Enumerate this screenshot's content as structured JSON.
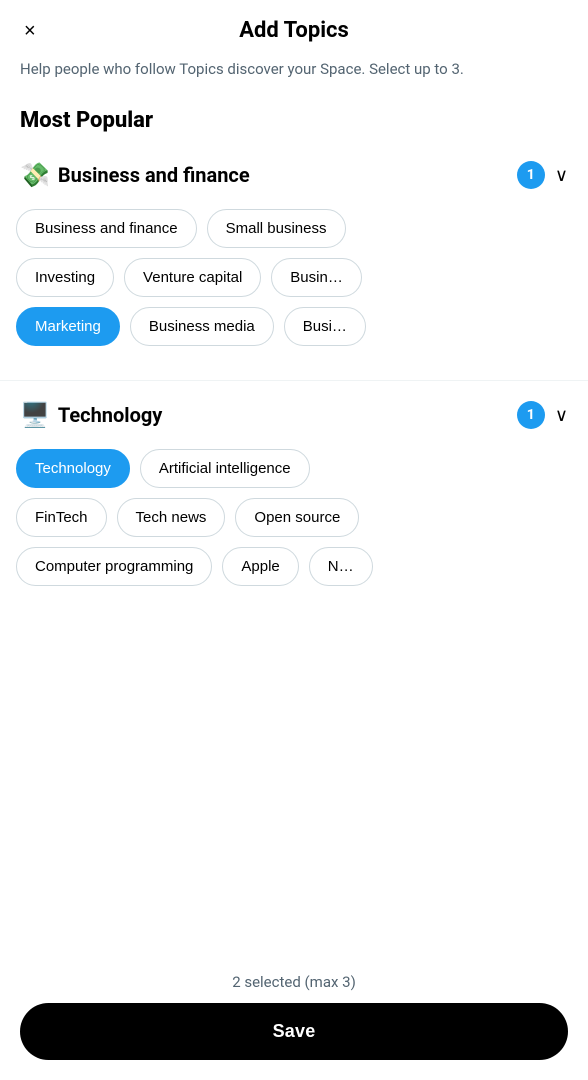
{
  "header": {
    "title": "Add Topics",
    "close_icon": "×"
  },
  "subtitle": "Help people who follow Topics discover your Space. Select up to 3.",
  "most_popular_label": "Most Popular",
  "categories": [
    {
      "id": "business",
      "emoji": "💸",
      "title": "Business and finance",
      "badge": "1",
      "rows": [
        [
          {
            "label": "Business and finance",
            "selected": false,
            "partial": false
          },
          {
            "label": "Small business",
            "selected": false,
            "partial": true
          }
        ],
        [
          {
            "label": "Investing",
            "selected": false,
            "partial": false
          },
          {
            "label": "Venture capital",
            "selected": false,
            "partial": false
          },
          {
            "label": "Busin…",
            "selected": false,
            "partial": true
          }
        ],
        [
          {
            "label": "Marketing",
            "selected": true,
            "partial": false
          },
          {
            "label": "Business media",
            "selected": false,
            "partial": false
          },
          {
            "label": "Busi…",
            "selected": false,
            "partial": true
          }
        ]
      ]
    },
    {
      "id": "technology",
      "emoji": "🖥️",
      "title": "Technology",
      "badge": "1",
      "rows": [
        [
          {
            "label": "Technology",
            "selected": true,
            "partial": false
          },
          {
            "label": "Artificial intelligence",
            "selected": false,
            "partial": false
          },
          {
            "label": "…",
            "selected": false,
            "partial": true
          }
        ],
        [
          {
            "label": "FinTech",
            "selected": false,
            "partial": false
          },
          {
            "label": "Tech news",
            "selected": false,
            "partial": false
          },
          {
            "label": "Open source",
            "selected": false,
            "partial": true
          }
        ],
        [
          {
            "label": "Computer programming",
            "selected": false,
            "partial": false
          },
          {
            "label": "Apple",
            "selected": false,
            "partial": false
          },
          {
            "label": "N…",
            "selected": false,
            "partial": true
          }
        ]
      ]
    }
  ],
  "footer": {
    "selected_count_text": "2 selected (max 3)",
    "save_button_label": "Save"
  }
}
